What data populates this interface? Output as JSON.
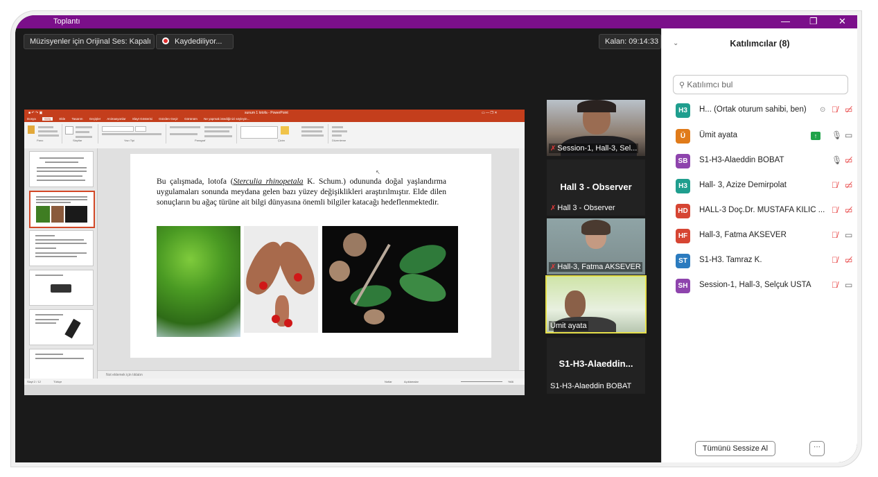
{
  "window": {
    "title": "Toplantı",
    "minimize": "—",
    "restore": "❐",
    "close": "✕"
  },
  "toolbar": {
    "original_sound": "Müzisyenler için Orijinal Ses: Kapalı",
    "recording": "Kaydediliyor...",
    "timer": "Kalan: 09:14:33"
  },
  "ppt": {
    "doc_title": "sunum 1 lotofa - PowerPoint",
    "tabs": [
      "Dosya",
      "Giriş",
      "Ekle",
      "Tasarım",
      "Geçişler",
      "Animasyonlar",
      "Slayt Gösterisi",
      "Gözden Geçir",
      "Görünüm"
    ],
    "search_hint": "Ne yapmak istediğinizi söyleyin...",
    "ribbon_groups": [
      "Pano",
      "Slaytlar",
      "Yazı Tipi",
      "Paragraf",
      "Çizim",
      "Düzenleme"
    ],
    "slide_text_1": "Bu çalışmada, lotofa (",
    "slide_text_species": "Sterculia rhinopetala",
    "slide_text_2": " K. Schum.) odununda doğal yaşlandırma uygulamaları sonunda meydana gelen bazı yüzey değişiklikleri araştırılmıştır. Elde dilen sonuçların bu ağaç türüne ait bilgi dünyasına önemli bilgiler katacağı hedeflenmektedir.",
    "notes_hint": "Not eklemek için tıklatın",
    "status_left": "Slayt 2 / 12",
    "status_lang": "Türkçe",
    "status_notes": "Notlar",
    "status_comments": "Açıklamalar",
    "status_zoom": "%66"
  },
  "videos": [
    {
      "name": "Session-1, Hall-3, Sel...",
      "muted": true
    },
    {
      "name": "Hall 3 - Observer",
      "center": "Hall 3 - Observer",
      "muted": true
    },
    {
      "name": "Hall-3, Fatma AKSEVER",
      "muted": true
    },
    {
      "name": "Ümit ayata",
      "muted": false
    },
    {
      "name": "S1-H3-Alaeddin BOBAT",
      "center": "S1-H3-Alaeddin..."
    }
  ],
  "panel": {
    "title": "Katılımcılar (8)",
    "search_placeholder": "Katılımcı bul",
    "participants": [
      {
        "initials": "H3",
        "color": "#1f9e8e",
        "name": "H... (Ortak oturum sahibi, ben)"
      },
      {
        "initials": "Ü",
        "color": "#e07b1a",
        "name": "Ümit ayata"
      },
      {
        "initials": "SB",
        "color": "#8e44ad",
        "name": "S1-H3-Alaeddin BOBAT"
      },
      {
        "initials": "H3",
        "color": "#1f9e8e",
        "name": "Hall- 3, Azize Demirpolat"
      },
      {
        "initials": "HD",
        "color": "#d64533",
        "name": "HALL-3 Doç.Dr. MUSTAFA KILIC ..."
      },
      {
        "initials": "HF",
        "color": "#d64533",
        "name": "Hall-3, Fatma AKSEVER"
      },
      {
        "initials": "ST",
        "color": "#2b7bbf",
        "name": "S1-H3. Tamraz K."
      },
      {
        "initials": "SH",
        "color": "#8e44ad",
        "name": "Session-1, Hall-3, Selçuk USTA"
      }
    ],
    "mute_all": "Tümünü Sessize Al",
    "more": "···"
  }
}
